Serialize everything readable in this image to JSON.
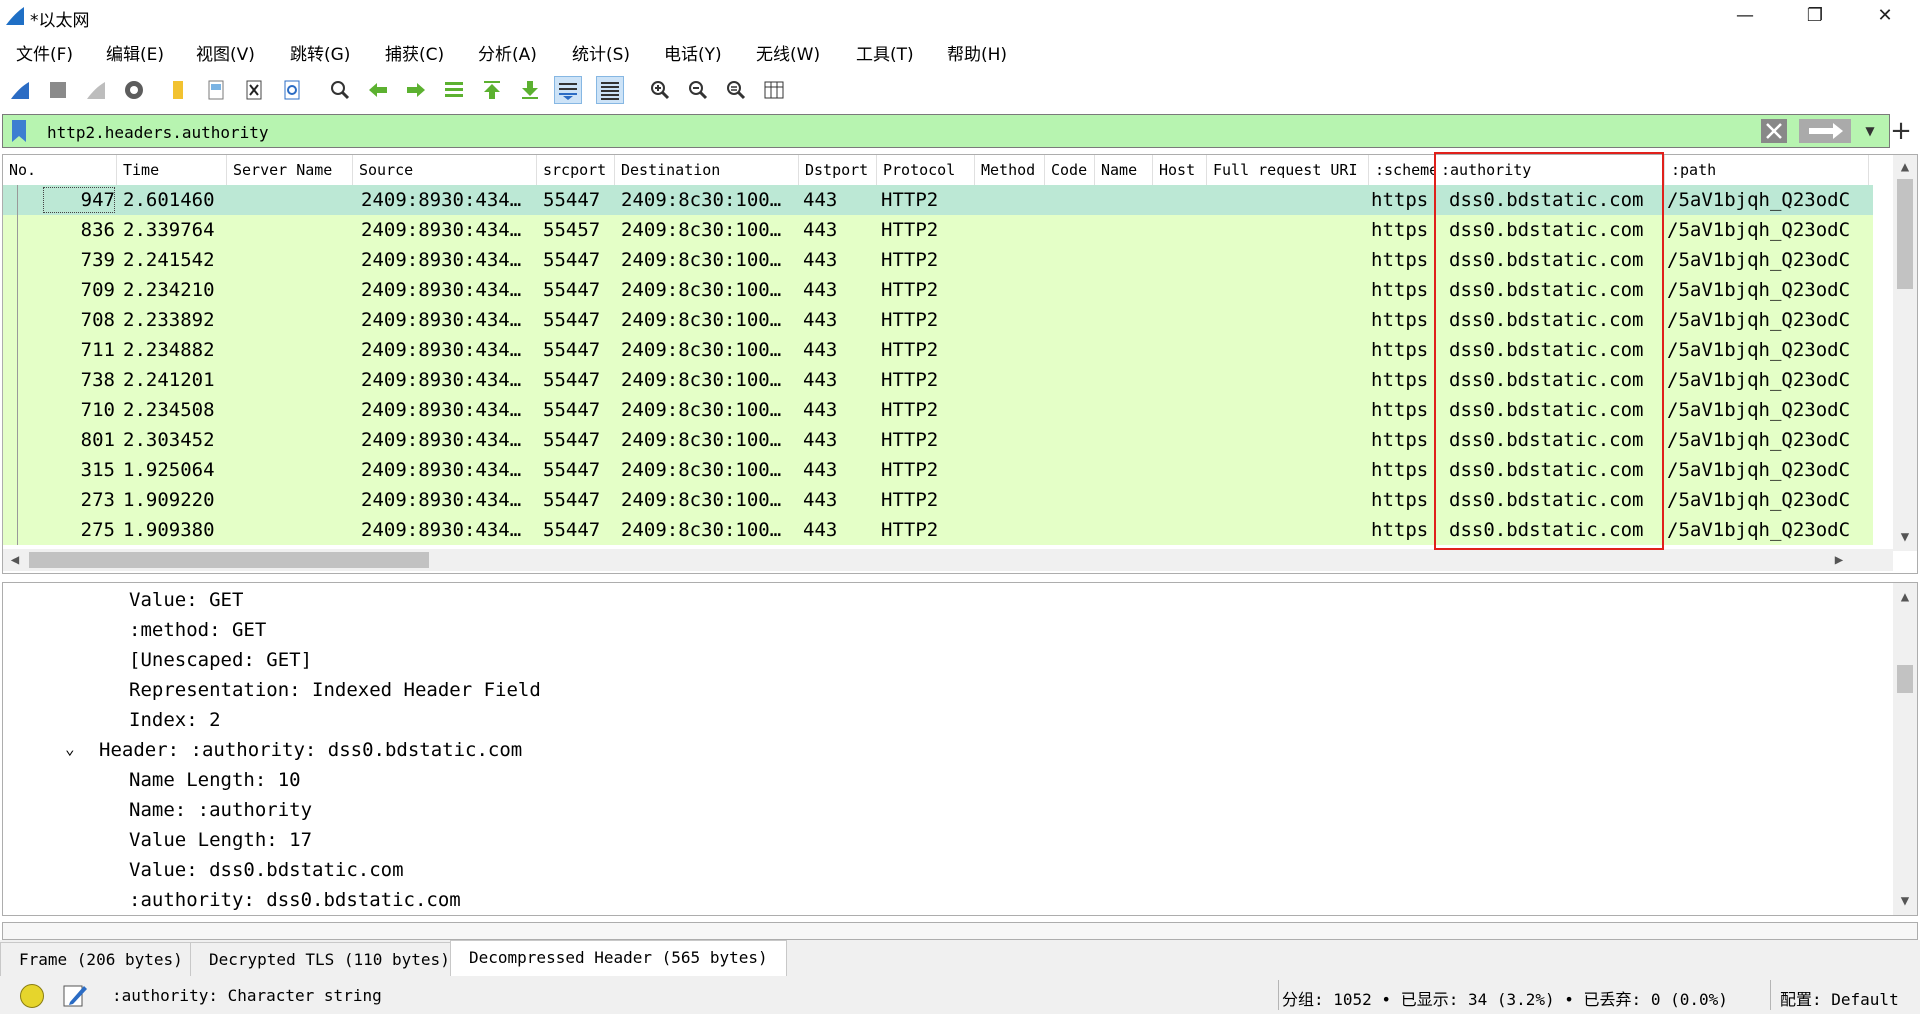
{
  "window": {
    "title": "*以太网",
    "minimize": "—",
    "restore": "❐",
    "close": "✕"
  },
  "menu": [
    "文件(F)",
    "编辑(E)",
    "视图(V)",
    "跳转(G)",
    "捕获(C)",
    "分析(A)",
    "统计(S)",
    "电话(Y)",
    "无线(W)",
    "工具(T)",
    "帮助(H)"
  ],
  "toolbar": {
    "icons": [
      "shark-fin-start-capture-icon",
      "stop-capture-icon",
      "restart-capture-icon",
      "capture-options-icon",
      "open-file-icon",
      "save-file-icon",
      "close-file-icon",
      "reload-file-icon",
      "find-packet-icon",
      "go-back-icon",
      "go-forward-icon",
      "go-to-packet-icon",
      "go-to-first-packet-icon",
      "go-to-last-packet-icon",
      "auto-scroll-icon",
      "colorize-icon",
      "zoom-in-icon",
      "zoom-out-icon",
      "normal-size-icon",
      "resize-columns-icon"
    ]
  },
  "filter": {
    "value": "http2.headers.authority"
  },
  "packet_list": {
    "columns": [
      "No.",
      "Time",
      "Server Name",
      "Source",
      "srcport",
      "Destination",
      "Dstport",
      "Protocol",
      "Method",
      "Code",
      "Name",
      "Host",
      "Full request URI",
      ":scheme",
      ":authority",
      ":path"
    ],
    "rows": [
      {
        "no": "947",
        "time": "2.601460",
        "source": "2409:8930:434…",
        "srcport": "55447",
        "destination": "2409:8c30:100…",
        "dstport": "443",
        "protocol": "HTTP2",
        "scheme": "https",
        "authority": "dss0.bdstatic.com",
        "path": "/5aV1bjqh_Q23odC"
      },
      {
        "no": "836",
        "time": "2.339764",
        "source": "2409:8930:434…",
        "srcport": "55457",
        "destination": "2409:8c30:100…",
        "dstport": "443",
        "protocol": "HTTP2",
        "scheme": "https",
        "authority": "dss0.bdstatic.com",
        "path": "/5aV1bjqh_Q23odC"
      },
      {
        "no": "739",
        "time": "2.241542",
        "source": "2409:8930:434…",
        "srcport": "55447",
        "destination": "2409:8c30:100…",
        "dstport": "443",
        "protocol": "HTTP2",
        "scheme": "https",
        "authority": "dss0.bdstatic.com",
        "path": "/5aV1bjqh_Q23odC"
      },
      {
        "no": "709",
        "time": "2.234210",
        "source": "2409:8930:434…",
        "srcport": "55447",
        "destination": "2409:8c30:100…",
        "dstport": "443",
        "protocol": "HTTP2",
        "scheme": "https",
        "authority": "dss0.bdstatic.com",
        "path": "/5aV1bjqh_Q23odC"
      },
      {
        "no": "708",
        "time": "2.233892",
        "source": "2409:8930:434…",
        "srcport": "55447",
        "destination": "2409:8c30:100…",
        "dstport": "443",
        "protocol": "HTTP2",
        "scheme": "https",
        "authority": "dss0.bdstatic.com",
        "path": "/5aV1bjqh_Q23odC"
      },
      {
        "no": "711",
        "time": "2.234882",
        "source": "2409:8930:434…",
        "srcport": "55447",
        "destination": "2409:8c30:100…",
        "dstport": "443",
        "protocol": "HTTP2",
        "scheme": "https",
        "authority": "dss0.bdstatic.com",
        "path": "/5aV1bjqh_Q23odC"
      },
      {
        "no": "738",
        "time": "2.241201",
        "source": "2409:8930:434…",
        "srcport": "55447",
        "destination": "2409:8c30:100…",
        "dstport": "443",
        "protocol": "HTTP2",
        "scheme": "https",
        "authority": "dss0.bdstatic.com",
        "path": "/5aV1bjqh_Q23odC"
      },
      {
        "no": "710",
        "time": "2.234508",
        "source": "2409:8930:434…",
        "srcport": "55447",
        "destination": "2409:8c30:100…",
        "dstport": "443",
        "protocol": "HTTP2",
        "scheme": "https",
        "authority": "dss0.bdstatic.com",
        "path": "/5aV1bjqh_Q23odC"
      },
      {
        "no": "801",
        "time": "2.303452",
        "source": "2409:8930:434…",
        "srcport": "55447",
        "destination": "2409:8c30:100…",
        "dstport": "443",
        "protocol": "HTTP2",
        "scheme": "https",
        "authority": "dss0.bdstatic.com",
        "path": "/5aV1bjqh_Q23odC"
      },
      {
        "no": "315",
        "time": "1.925064",
        "source": "2409:8930:434…",
        "srcport": "55447",
        "destination": "2409:8c30:100…",
        "dstport": "443",
        "protocol": "HTTP2",
        "scheme": "https",
        "authority": "dss0.bdstatic.com",
        "path": "/5aV1bjqh_Q23odC"
      },
      {
        "no": "273",
        "time": "1.909220",
        "source": "2409:8930:434…",
        "srcport": "55447",
        "destination": "2409:8c30:100…",
        "dstport": "443",
        "protocol": "HTTP2",
        "scheme": "https",
        "authority": "dss0.bdstatic.com",
        "path": "/5aV1bjqh_Q23odC"
      },
      {
        "no": "275",
        "time": "1.909380",
        "source": "2409:8930:434…",
        "srcport": "55447",
        "destination": "2409:8c30:100…",
        "dstport": "443",
        "protocol": "HTTP2",
        "scheme": "https",
        "authority": "dss0.bdstatic.com",
        "path": "/5aV1bjqh_Q23odC"
      }
    ],
    "row_color": "#e4ffc7",
    "selected_color": "#bce8d5",
    "highlight_color": "#e0201b"
  },
  "details": {
    "lines": [
      {
        "text": "Value: GET",
        "level": 2
      },
      {
        "text": ":method: GET",
        "level": 2
      },
      {
        "text": "[Unescaped: GET]",
        "level": 2
      },
      {
        "text": "Representation: Indexed Header Field",
        "level": 2
      },
      {
        "text": "Index: 2",
        "level": 2
      },
      {
        "text": "Header: :authority: dss0.bdstatic.com",
        "level": 1,
        "expanded": true
      },
      {
        "text": "Name Length: 10",
        "level": 2
      },
      {
        "text": "Name: :authority",
        "level": 2
      },
      {
        "text": "Value Length: 17",
        "level": 2
      },
      {
        "text": "Value: dss0.bdstatic.com",
        "level": 2
      },
      {
        "text": ":authority: dss0.bdstatic.com",
        "level": 2
      }
    ]
  },
  "tabs": [
    "Frame (206 bytes)",
    "Decrypted TLS (110 bytes)",
    "Decompressed Header (565 bytes)"
  ],
  "status": {
    "field_desc": ":authority: Character string",
    "stats": "分组: 1052 • 已显示: 34 (3.2%) • 已丢弃: 0 (0.0%)",
    "profile": "配置: Default"
  },
  "filter_color": "#b7f4b0"
}
